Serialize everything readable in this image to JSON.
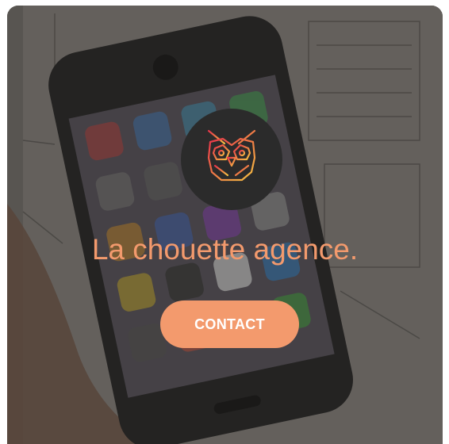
{
  "brand": {
    "logo_icon": "owl-icon",
    "headline": "La chouette agence.",
    "accent_color": "#f39a6d",
    "logo_bg_color": "#2b2b2b"
  },
  "cta": {
    "label": "CONTACT"
  }
}
